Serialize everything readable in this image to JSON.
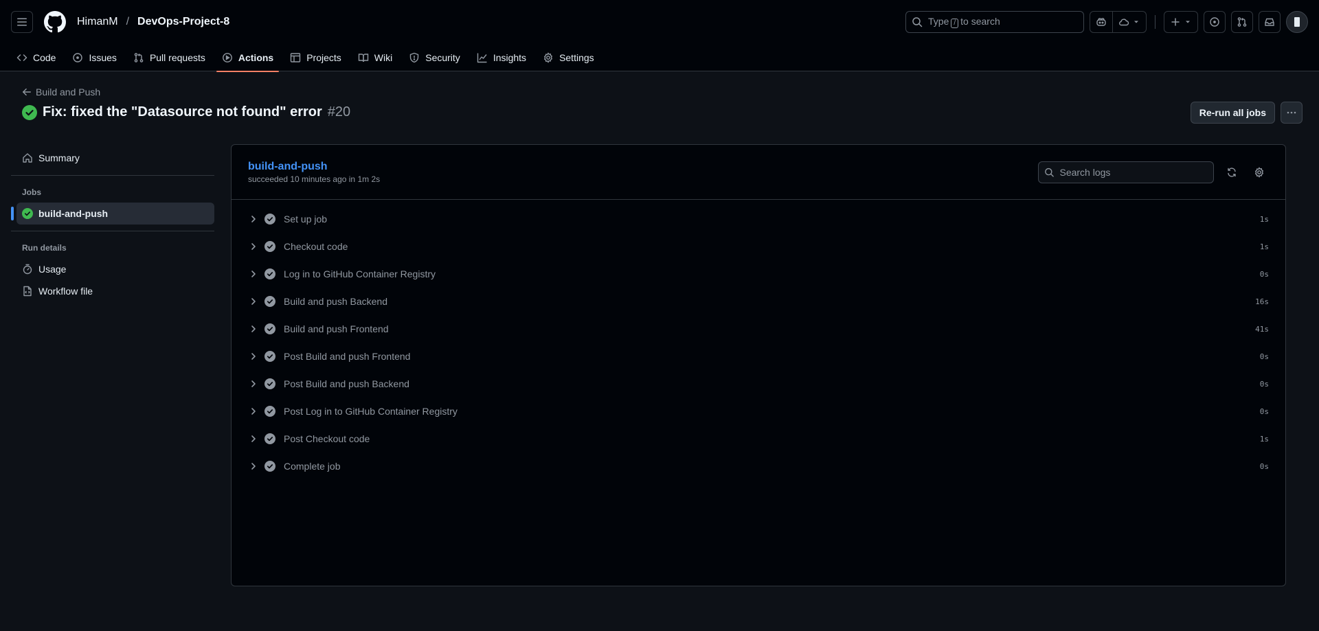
{
  "header": {
    "owner": "HimanM",
    "separator": "/",
    "repo": "DevOps-Project-8",
    "search": {
      "prefix": "Type",
      "key": "/",
      "suffix": "to search"
    }
  },
  "tabs": [
    {
      "label": "Code",
      "icon": "code-icon"
    },
    {
      "label": "Issues",
      "icon": "issue-icon"
    },
    {
      "label": "Pull requests",
      "icon": "pull-request-icon"
    },
    {
      "label": "Actions",
      "icon": "play-icon",
      "selected": true
    },
    {
      "label": "Projects",
      "icon": "table-icon"
    },
    {
      "label": "Wiki",
      "icon": "book-icon"
    },
    {
      "label": "Security",
      "icon": "shield-icon"
    },
    {
      "label": "Insights",
      "icon": "graph-icon"
    },
    {
      "label": "Settings",
      "icon": "gear-icon"
    }
  ],
  "run": {
    "workflow_name": "Build and Push",
    "title_prefix": "Fix:",
    "title_rest": "fixed the \"Datasource not found\" error",
    "number": "#20",
    "rerun_label": "Re-run all jobs"
  },
  "sidebar": {
    "summary_label": "Summary",
    "jobs_heading": "Jobs",
    "job_label": "build-and-push",
    "run_details_heading": "Run details",
    "usage_label": "Usage",
    "workflow_file_label": "Workflow file"
  },
  "job": {
    "name": "build-and-push",
    "meta": "succeeded 10 minutes ago in 1m 2s",
    "search_placeholder": "Search logs",
    "steps": [
      {
        "name": "Set up job",
        "duration": "1s"
      },
      {
        "name": "Checkout code",
        "duration": "1s"
      },
      {
        "name": "Log in to GitHub Container Registry",
        "duration": "0s"
      },
      {
        "name": "Build and push Backend",
        "duration": "16s"
      },
      {
        "name": "Build and push Frontend",
        "duration": "41s"
      },
      {
        "name": "Post Build and push Frontend",
        "duration": "0s"
      },
      {
        "name": "Post Build and push Backend",
        "duration": "0s"
      },
      {
        "name": "Post Log in to GitHub Container Registry",
        "duration": "0s"
      },
      {
        "name": "Post Checkout code",
        "duration": "1s"
      },
      {
        "name": "Complete job",
        "duration": "0s"
      }
    ]
  },
  "colors": {
    "success": "#3fb950",
    "accent": "#4493f8",
    "tab_underline": "#f78166"
  }
}
